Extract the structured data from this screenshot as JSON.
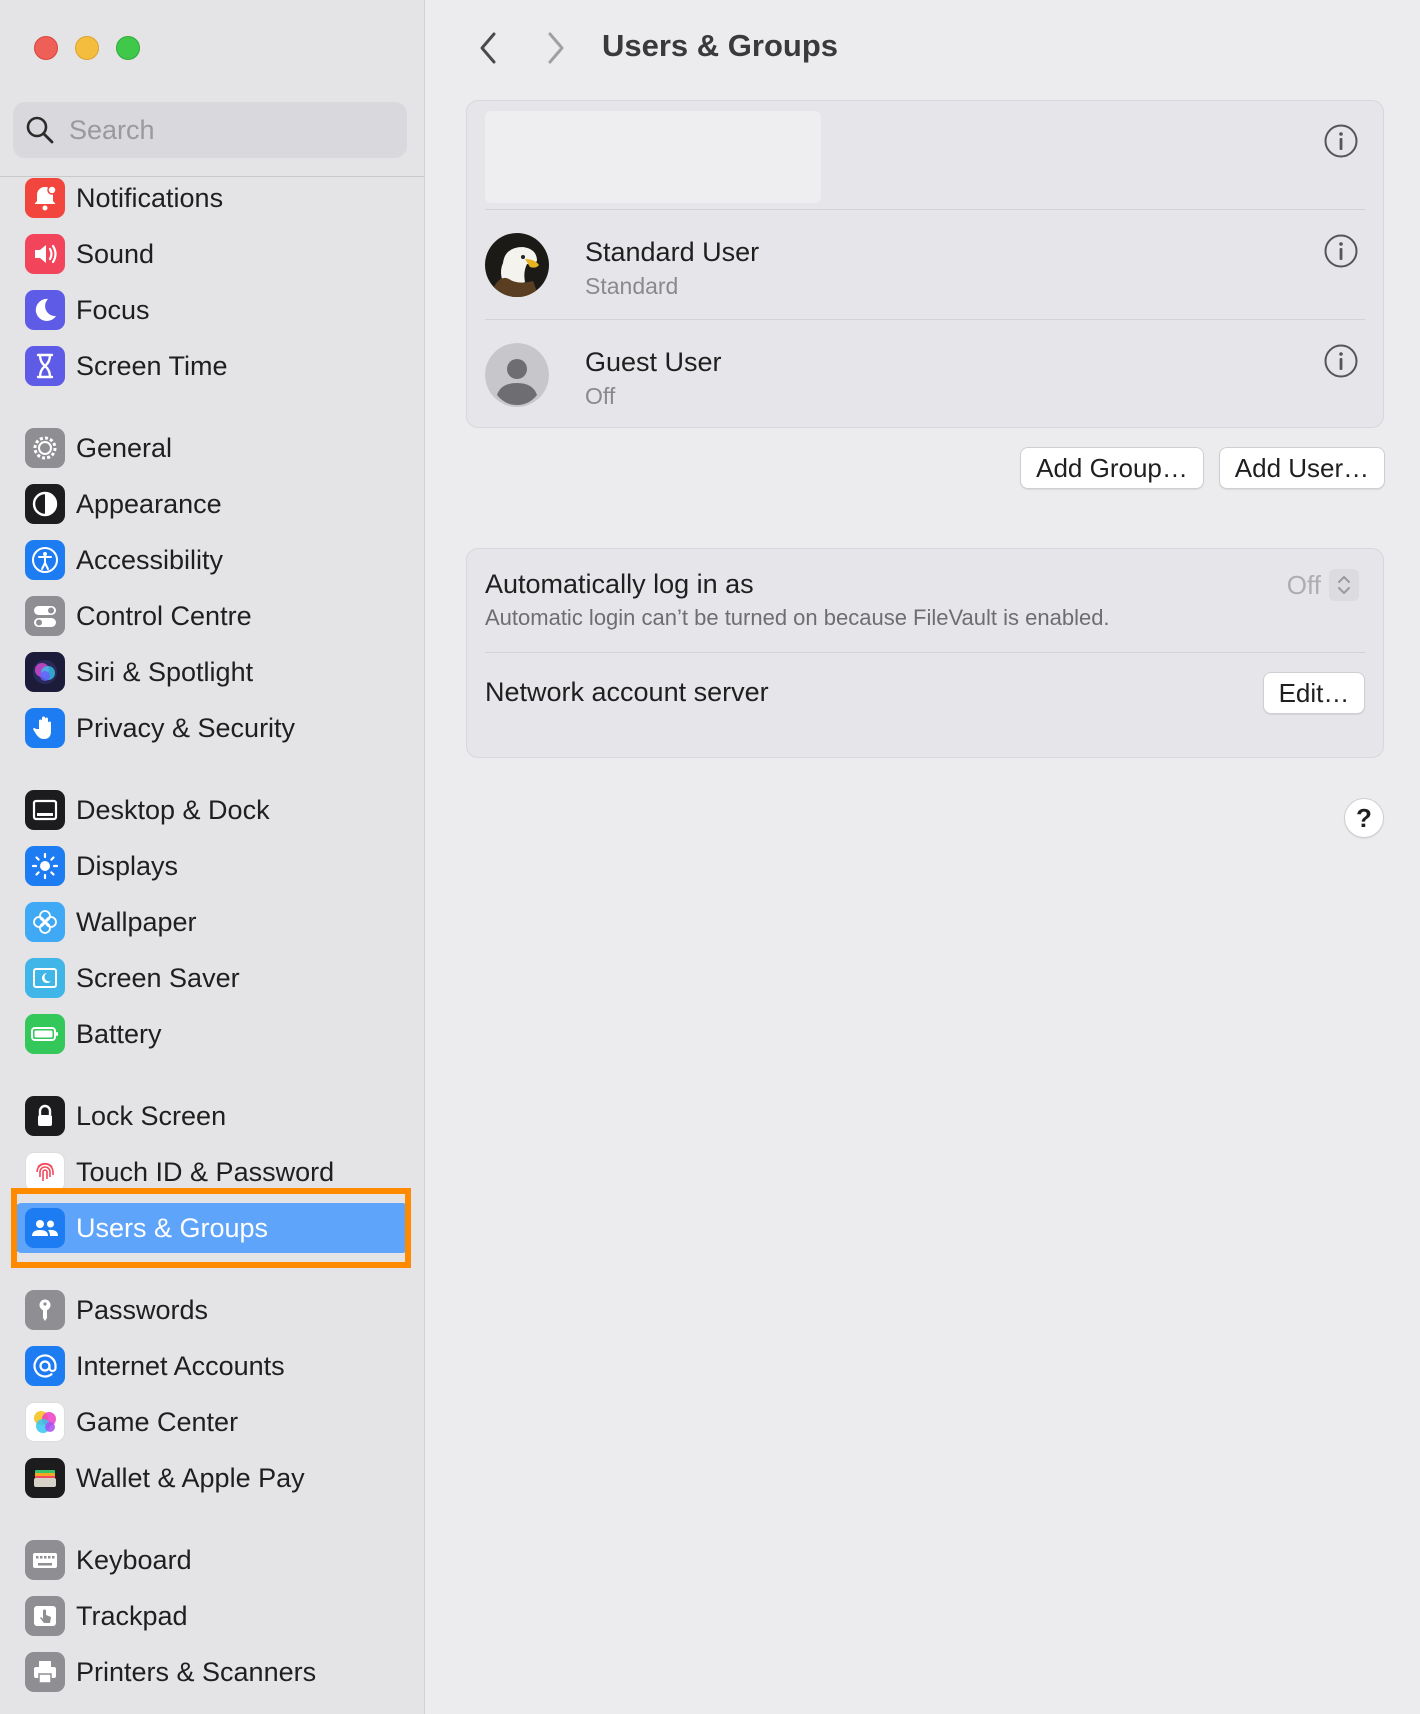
{
  "window": {
    "page_title": "Users & Groups"
  },
  "search": {
    "placeholder": "Search"
  },
  "sidebar": {
    "items": [
      {
        "label": "Notifications",
        "icon": "bell-icon",
        "color": "#f2453d"
      },
      {
        "label": "Sound",
        "icon": "speaker-icon",
        "color": "#f2455b"
      },
      {
        "label": "Focus",
        "icon": "moon-icon",
        "color": "#5e5ce6"
      },
      {
        "label": "Screen Time",
        "icon": "hourglass-icon",
        "color": "#5e5ce6"
      },
      {
        "label": "General",
        "icon": "gear-icon",
        "color": "#8e8e93"
      },
      {
        "label": "Appearance",
        "icon": "appearance-icon",
        "color": "#1c1c1e"
      },
      {
        "label": "Accessibility",
        "icon": "accessibility-icon",
        "color": "#1e7cf2"
      },
      {
        "label": "Control Centre",
        "icon": "toggles-icon",
        "color": "#8e8e93"
      },
      {
        "label": "Siri & Spotlight",
        "icon": "siri-icon",
        "color": "#1c1c3a"
      },
      {
        "label": "Privacy & Security",
        "icon": "hand-icon",
        "color": "#1e7cf2"
      },
      {
        "label": "Desktop & Dock",
        "icon": "dock-icon",
        "color": "#1c1c1e"
      },
      {
        "label": "Displays",
        "icon": "sun-icon",
        "color": "#1e7cf2"
      },
      {
        "label": "Wallpaper",
        "icon": "flower-icon",
        "color": "#3fa9f5"
      },
      {
        "label": "Screen Saver",
        "icon": "screen-saver-icon",
        "color": "#3fb5e8"
      },
      {
        "label": "Battery",
        "icon": "battery-icon",
        "color": "#34c759"
      },
      {
        "label": "Lock Screen",
        "icon": "lock-icon",
        "color": "#1c1c1e"
      },
      {
        "label": "Touch ID & Password",
        "icon": "fingerprint-icon",
        "color": "#ffffff"
      },
      {
        "label": "Users & Groups",
        "icon": "users-icon",
        "color": "#1e7cf2",
        "selected": true
      },
      {
        "label": "Passwords",
        "icon": "key-icon",
        "color": "#8e8e93"
      },
      {
        "label": "Internet Accounts",
        "icon": "at-icon",
        "color": "#1e7cf2"
      },
      {
        "label": "Game Center",
        "icon": "game-center-icon",
        "color": "#ffffff"
      },
      {
        "label": "Wallet & Apple Pay",
        "icon": "wallet-icon",
        "color": "#1c1c1e"
      },
      {
        "label": "Keyboard",
        "icon": "keyboard-icon",
        "color": "#8e8e93"
      },
      {
        "label": "Trackpad",
        "icon": "trackpad-icon",
        "color": "#8e8e93"
      },
      {
        "label": "Printers & Scanners",
        "icon": "printer-icon",
        "color": "#8e8e93"
      }
    ]
  },
  "users": [
    {
      "name": "Standard User",
      "role": "Standard",
      "avatar": "eagle-avatar"
    },
    {
      "name": "Guest User",
      "role": "Off",
      "avatar": "generic-person-avatar"
    }
  ],
  "buttons": {
    "add_group": "Add Group…",
    "add_user": "Add User…",
    "edit": "Edit…",
    "help": "?"
  },
  "login": {
    "title": "Automatically log in as",
    "description": "Automatic login can’t be turned on because FileVault is enabled.",
    "value": "Off"
  },
  "network": {
    "label": "Network account server"
  },
  "colors": {
    "accent": "#5ea4fb",
    "highlight": "#ff8a00"
  }
}
